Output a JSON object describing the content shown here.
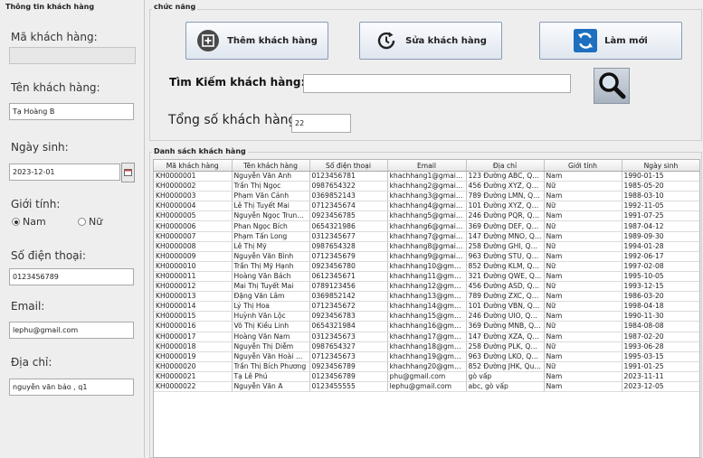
{
  "left_panel": {
    "group_title": "Thông tin khách hàng",
    "customer_id_label": "Mã khách hàng:",
    "customer_id_value": "",
    "name_label": "Tên khách hàng:",
    "name_value": "Tạ Hoàng B",
    "dob_label": "Ngày sinh:",
    "dob_value": "2023-12-01",
    "gender_label": "Giới tính:",
    "gender_options": [
      "Nam",
      "Nữ"
    ],
    "gender_selected": "Nam",
    "phone_label": "Số điện thoại:",
    "phone_value": "0123456789",
    "email_label": "Email:",
    "email_value": "lephu@gmail.com",
    "address_label": "Địa chỉ:",
    "address_value": "nguyễn văn bảo , q1"
  },
  "functions": {
    "group_title": "chức năng",
    "add_label": "Thêm khách hàng",
    "edit_label": "Sửa khách hàng",
    "refresh_label": "Làm mới",
    "search_label": "Tìm Kiếm khách hàng:",
    "search_value": "",
    "total_label": "Tổng số khách hàng:",
    "total_value": "22"
  },
  "list": {
    "group_title": "Danh sách khách hàng",
    "columns": [
      "Mã khách hàng",
      "Tên khách hàng",
      "Số điện thoại",
      "Email",
      "Địa chỉ",
      "Giới tính",
      "Ngày sinh"
    ],
    "rows": [
      [
        "KH0000001",
        "Nguyễn Văn Anh",
        "0123456781",
        "khachhang1@gmail.c...",
        "123 Đường ABC, Qu...",
        "Nam",
        "1990-01-15"
      ],
      [
        "KH0000002",
        "Trần Thị Ngọc",
        "0987654322",
        "khachhang2@gmail.c...",
        "456 Đường XYZ, Quậ...",
        "Nữ",
        "1985-05-20"
      ],
      [
        "KH0000003",
        "Phạm Văn Cảnh",
        "0369852143",
        "khachhang3@gmail.c...",
        "789 Đường LMN, Qu...",
        "Nam",
        "1988-03-10"
      ],
      [
        "KH0000004",
        "Lê Thị Tuyết Mai",
        "0712345674",
        "khachhang4@gmail.c...",
        "101 Đường XYZ, Quậ...",
        "Nữ",
        "1992-11-05"
      ],
      [
        "KH0000005",
        "Nguyễn Ngọc Trung ...",
        "0923456785",
        "khachhang5@gmail.c...",
        "246 Đường PQR, Qu...",
        "Nam",
        "1991-07-25"
      ],
      [
        "KH0000006",
        "Phan Ngọc Bích",
        "0654321986",
        "khachhang6@gmail.c...",
        "369 Đường DEF, Qu...",
        "Nữ",
        "1987-04-12"
      ],
      [
        "KH0000007",
        "Phạm Tấn Long",
        "0312345677",
        "khachhang7@gmail.c...",
        "147 Đường MNO, Qu...",
        "Nam",
        "1989-09-30"
      ],
      [
        "KH0000008",
        "Lê Thị Mỹ",
        "0987654328",
        "khachhang8@gmail.c...",
        "258 Đường GHI, Quậ...",
        "Nữ",
        "1994-01-28"
      ],
      [
        "KH0000009",
        "Nguyễn Văn Bình",
        "0712345679",
        "khachhang9@gmail.c...",
        "963 Đường STU, Qu...",
        "Nam",
        "1992-06-17"
      ],
      [
        "KH0000010",
        "Trần Thị Mỹ Hạnh",
        "0923456780",
        "khachhang10@gmail...",
        "852 Đường KLM, Qu...",
        "Nữ",
        "1997-02-08"
      ],
      [
        "KH0000011",
        "Hoàng Văn Bách",
        "0612345671",
        "khachhang11@gmail...",
        "321 Đường QWE, Q...",
        "Nam",
        "1995-10-05"
      ],
      [
        "KH0000012",
        "Mai Thị Tuyết Mai",
        "0789123456",
        "khachhang12@gmail...",
        "456 Đường ASD, Qu...",
        "Nữ",
        "1993-12-15"
      ],
      [
        "KH0000013",
        "Đặng Văn Lâm",
        "0369852142",
        "khachhang13@gmail...",
        "789 Đường ZXC, Quậ...",
        "Nam",
        "1986-03-20"
      ],
      [
        "KH0000014",
        "Lý Thị Hoa",
        "0712345672",
        "khachhang14@gmail...",
        "101 Đường VBN, Qu...",
        "Nữ",
        "1998-04-18"
      ],
      [
        "KH0000015",
        "Huỳnh Văn Lộc",
        "0923456783",
        "khachhang15@gmail...",
        "246 Đường UIO, Quậ...",
        "Nam",
        "1990-11-30"
      ],
      [
        "KH0000016",
        "Võ Thị Kiều Linh",
        "0654321984",
        "khachhang16@gmail...",
        "369 Đường MNB, Qu...",
        "Nữ",
        "1984-08-08"
      ],
      [
        "KH0000017",
        "Hoàng Văn Nam",
        "0312345673",
        "khachhang17@gmail...",
        "147 Đường XZA, Quậ...",
        "Nam",
        "1987-02-20"
      ],
      [
        "KH0000018",
        "Nguyễn Thị Diễm",
        "0987654327",
        "khachhang18@gmail...",
        "258 Đường PLK, Quậ...",
        "Nữ",
        "1993-06-28"
      ],
      [
        "KH0000019",
        "Nguyễn Văn Hoài Nam",
        "0712345673",
        "khachhang19@gmail...",
        "963 Đường LKO, Qu...",
        "Nam",
        "1995-03-15"
      ],
      [
        "KH0000020",
        "Trần Thị Bích Phương",
        "0923456789",
        "khachhang20@gmail...",
        "852 Đường JHK, Quậ...",
        "Nữ",
        "1991-01-25"
      ],
      [
        "KH0000021",
        "Tạ Lê Phú",
        "0123456789",
        "phu@gmail.com",
        "gò vấp",
        "Nam",
        "2023-11-11"
      ],
      [
        "KH0000022",
        "Nguyễn Văn A",
        "0123455555",
        "lephu@gmail.com",
        "abc, gò vấp",
        "Nam",
        "2023-12-05"
      ]
    ]
  },
  "colors": {
    "accent_blue": "#1f6fbf",
    "icon_dark": "#2b2b2b"
  }
}
